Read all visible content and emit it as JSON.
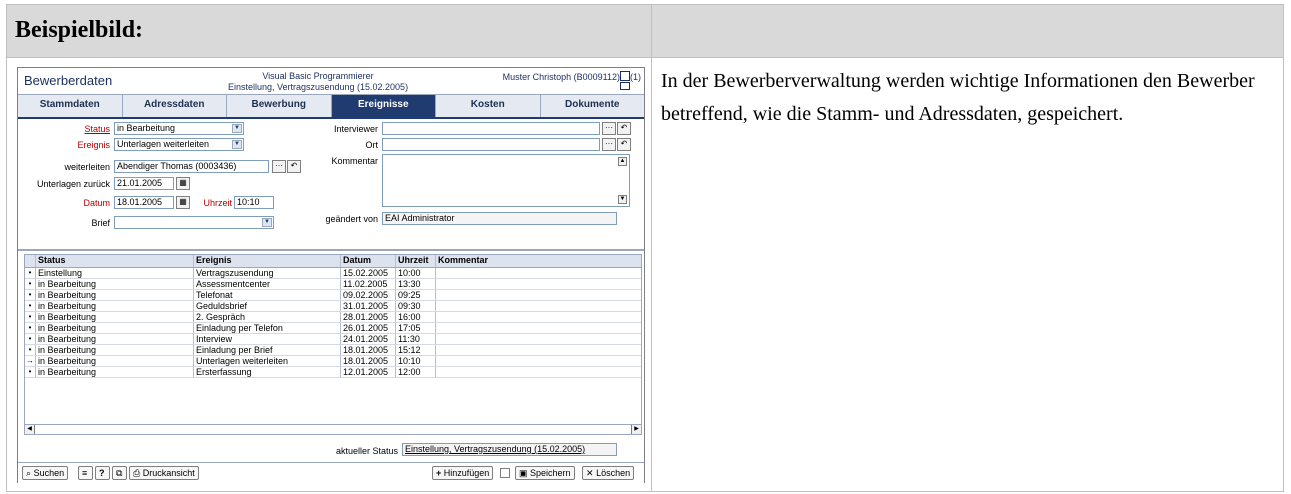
{
  "doc": {
    "header_title": "Beispielbild:",
    "description": "In der Bewerberverwaltung werden wichtige Informationen den Bewerber betreffend, wie die Stamm- und Adressdaten, gespeichert."
  },
  "app": {
    "title": "Bewerberdaten",
    "center_line1": "Visual Basic Programmierer",
    "center_line2": "Einstellung, Vertragszusendung (15.02.2005)",
    "user": "Muster Christoph (B0009112)",
    "count": "(1)"
  },
  "tabs": [
    {
      "label": "Stammdaten",
      "active": false
    },
    {
      "label": "Adressdaten",
      "active": false
    },
    {
      "label": "Bewerbung",
      "active": false
    },
    {
      "label": "Ereignisse",
      "active": true
    },
    {
      "label": "Kosten",
      "active": false
    },
    {
      "label": "Dokumente",
      "active": false
    }
  ],
  "form": {
    "status_label": "Status",
    "status_value": "in Bearbeitung",
    "ereignis_label": "Ereignis",
    "ereignis_value": "Unterlagen weiterleiten",
    "weiterleiten_label": "weiterleiten",
    "weiterleiten_value": "Abendiger Thomas  (0003436)",
    "unterlagen_label": "Unterlagen zurück",
    "unterlagen_value": "21.01.2005",
    "datum_label": "Datum",
    "datum_value": "18.01.2005",
    "uhrzeit_label": "Uhrzeit",
    "uhrzeit_value": "10:10",
    "brief_label": "Brief",
    "brief_value": "",
    "interviewer_label": "Interviewer",
    "interviewer_value": "",
    "ort_label": "Ort",
    "ort_value": "",
    "kommentar_label": "Kommentar",
    "geaendert_label": "geändert von",
    "geaendert_value": "EAI Administrator"
  },
  "grid": {
    "headers": [
      "Status",
      "Ereignis",
      "Datum",
      "Uhrzeit",
      "Kommentar"
    ],
    "rows": [
      {
        "marker": "•",
        "status": "Einstellung",
        "ereignis": "Vertragszusendung",
        "datum": "15.02.2005",
        "uhrzeit": "10:00",
        "kommentar": ""
      },
      {
        "marker": "•",
        "status": "in Bearbeitung",
        "ereignis": "Assessmentcenter",
        "datum": "11.02.2005",
        "uhrzeit": "13:30",
        "kommentar": ""
      },
      {
        "marker": "•",
        "status": "in Bearbeitung",
        "ereignis": "Telefonat",
        "datum": "09.02.2005",
        "uhrzeit": "09:25",
        "kommentar": ""
      },
      {
        "marker": "•",
        "status": "in Bearbeitung",
        "ereignis": "Geduldsbrief",
        "datum": "31.01.2005",
        "uhrzeit": "09:30",
        "kommentar": ""
      },
      {
        "marker": "•",
        "status": "in Bearbeitung",
        "ereignis": "2. Gespräch",
        "datum": "28.01.2005",
        "uhrzeit": "16:00",
        "kommentar": ""
      },
      {
        "marker": "•",
        "status": "in Bearbeitung",
        "ereignis": "Einladung per Telefon",
        "datum": "26.01.2005",
        "uhrzeit": "17:05",
        "kommentar": ""
      },
      {
        "marker": "•",
        "status": "in Bearbeitung",
        "ereignis": "Interview",
        "datum": "24.01.2005",
        "uhrzeit": "11:30",
        "kommentar": ""
      },
      {
        "marker": "•",
        "status": "in Bearbeitung",
        "ereignis": "Einladung per Brief",
        "datum": "18.01.2005",
        "uhrzeit": "15:12",
        "kommentar": ""
      },
      {
        "marker": "→",
        "status": "in Bearbeitung",
        "ereignis": "Unterlagen weiterleiten",
        "datum": "18.01.2005",
        "uhrzeit": "10:10",
        "kommentar": ""
      },
      {
        "marker": "•",
        "status": "in Bearbeitung",
        "ereignis": "Ersterfassung",
        "datum": "12.01.2005",
        "uhrzeit": "12:00",
        "kommentar": ""
      }
    ]
  },
  "status_bar": {
    "label": "aktueller Status",
    "value": "Einstellung, Vertragszusendung (15.02.2005)"
  },
  "footer": {
    "search": "Suchen",
    "print": "Druckansicht",
    "add": "Hinzufügen",
    "save": "Speichern",
    "delete": "Löschen"
  },
  "icons": {
    "binoculars": "binoculars-icon",
    "list": "list-icon",
    "help": "help-icon",
    "copy": "copy-icon",
    "printer": "printer-icon",
    "plus": "plus-icon",
    "floppy": "floppy-icon",
    "x": "x-icon"
  }
}
